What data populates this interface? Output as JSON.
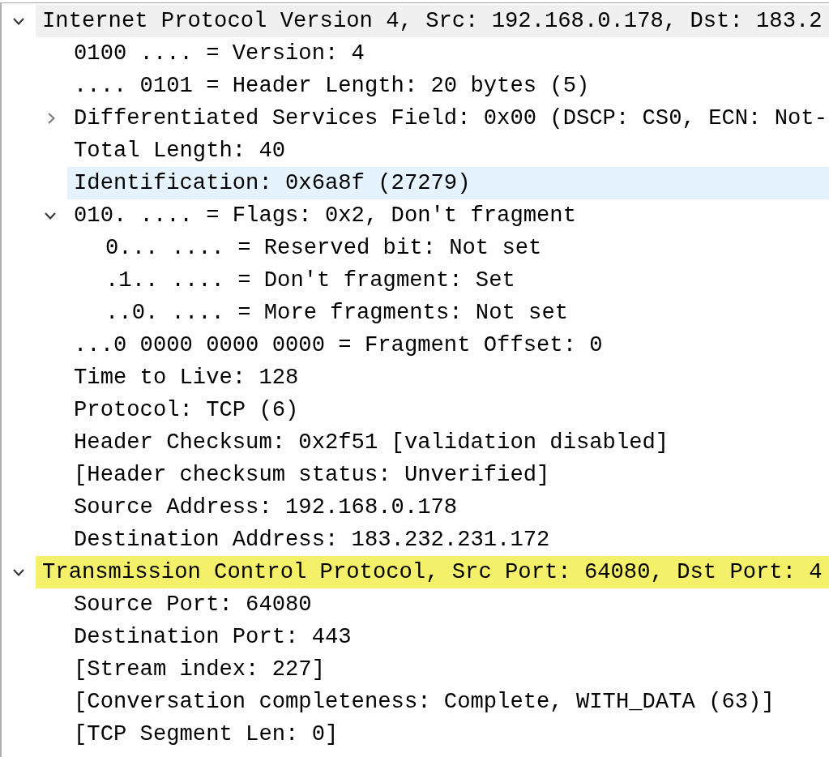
{
  "packet_details": [
    {
      "label": "Internet Protocol Version 4, Src: 192.168.0.178, Dst: 183.2",
      "selected": false,
      "expanded": true,
      "color": "#f0f0f0",
      "children": [
        {
          "label": "0100 .... = Version: 4",
          "selected": false
        },
        {
          "label": ".... 0101 = Header Length: 20 bytes (5)",
          "selected": false
        },
        {
          "label": "Differentiated Services Field: 0x00 (DSCP: CS0, ECN: Not-",
          "selected": false,
          "expanded": false
        },
        {
          "label": "Total Length: 40",
          "selected": false
        },
        {
          "label": "Identification: 0x6a8f (27279)",
          "selected": true
        },
        {
          "label": "010. .... = Flags: 0x2, Don't fragment",
          "selected": false,
          "expanded": true,
          "children": [
            {
              "label": "0... .... = Reserved bit: Not set",
              "selected": false
            },
            {
              "label": ".1.. .... = Don't fragment: Set",
              "selected": false
            },
            {
              "label": "..0. .... = More fragments: Not set",
              "selected": false
            }
          ]
        },
        {
          "label": "...0 0000 0000 0000 = Fragment Offset: 0",
          "selected": false
        },
        {
          "label": "Time to Live: 128",
          "selected": false
        },
        {
          "label": "Protocol: TCP (6)",
          "selected": false
        },
        {
          "label": "Header Checksum: 0x2f51 [validation disabled]",
          "selected": false
        },
        {
          "label": "[Header checksum status: Unverified]",
          "selected": false
        },
        {
          "label": "Source Address: 192.168.0.178",
          "selected": false
        },
        {
          "label": "Destination Address: 183.232.231.172",
          "selected": false
        }
      ]
    },
    {
      "label": "Transmission Control Protocol, Src Port: 64080, Dst Port: 4",
      "selected": false,
      "expanded": true,
      "color": "#f5f069",
      "children": [
        {
          "label": "Source Port: 64080",
          "selected": false
        },
        {
          "label": "Destination Port: 443",
          "selected": false
        },
        {
          "label": "[Stream index: 227]",
          "selected": false
        },
        {
          "label": "[Conversation completeness: Complete, WITH_DATA (63)]",
          "selected": false
        },
        {
          "label": "[TCP Segment Len: 0]",
          "selected": false
        }
      ]
    }
  ]
}
